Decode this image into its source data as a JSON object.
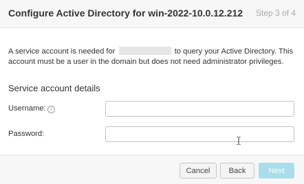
{
  "dialog": {
    "title": "Configure Active Directory for win-2022-10.0.12.212",
    "step": "Step 3 of 4"
  },
  "description": {
    "part1": "A service account is needed for",
    "part2": "to query your Active Directory. This account must be a user in the domain but does not need administrator privileges."
  },
  "section": {
    "title": "Service account details"
  },
  "fields": {
    "username_label": "Username:",
    "username_info_icon": "info-icon",
    "username_value": "",
    "password_label": "Password:",
    "password_value": ""
  },
  "footer": {
    "cancel_label": "Cancel",
    "back_label": "Back",
    "next_label": "Next"
  },
  "colors": {
    "next_button_disabled": "#a9dde9",
    "header_background": "#f7f7f7"
  }
}
